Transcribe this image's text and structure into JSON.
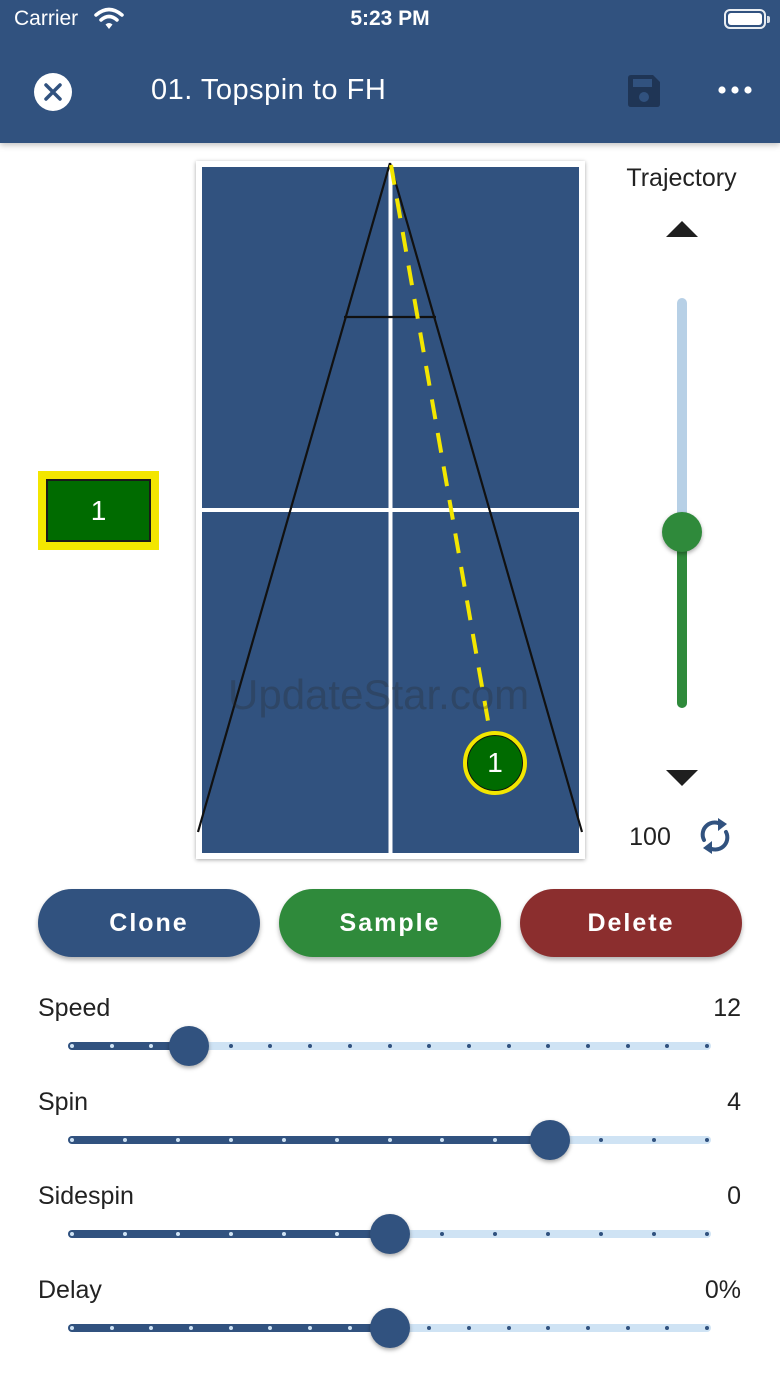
{
  "status_bar": {
    "carrier": "Carrier",
    "time": "5:23 PM"
  },
  "header": {
    "title": "01. Topspin to FH",
    "close_icon": "close-circle-icon",
    "save_icon": "floppy-disk-icon",
    "more_icon": "more-horizontal-icon"
  },
  "colors": {
    "header": "#31527f",
    "table": "#31527f",
    "green": "#2f8a3b",
    "red": "#8b2e2e",
    "marker_green": "#006b00",
    "highlight_yellow": "#f3e600",
    "track_light": "#cfe3f4"
  },
  "ball_sequence": {
    "selected_ball": "1"
  },
  "placement": {
    "marker_label": "1"
  },
  "watermark": "UpdateStar.com",
  "trajectory": {
    "label": "Trajectory",
    "value": "100",
    "level": 0.43,
    "up_icon": "triangle-up-icon",
    "down_icon": "triangle-down-icon",
    "refresh_icon": "refresh-icon"
  },
  "actions": {
    "clone": "Clone",
    "sample": "Sample",
    "delete": "Delete"
  },
  "sliders": [
    {
      "label": "Speed",
      "value": "12",
      "fraction": 0.1875,
      "steps": 16
    },
    {
      "label": "Spin",
      "value": "4",
      "fraction": 0.75,
      "steps": 12
    },
    {
      "label": "Sidespin",
      "value": "0",
      "fraction": 0.5,
      "steps": 12
    },
    {
      "label": "Delay",
      "value": "0%",
      "fraction": 0.5,
      "steps": 16
    }
  ]
}
